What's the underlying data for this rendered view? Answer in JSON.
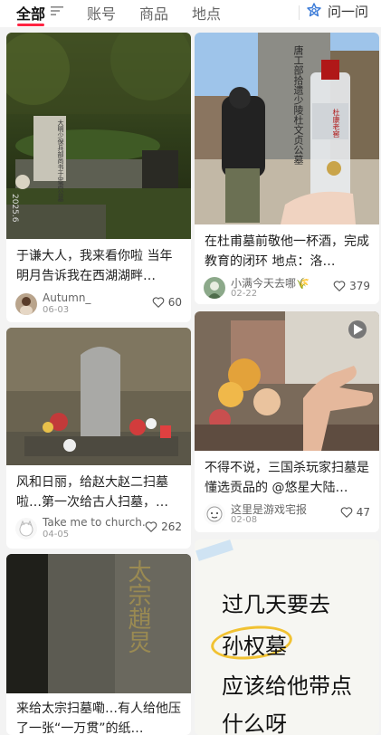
{
  "tabs": [
    "全部",
    "账号",
    "商品",
    "地点"
  ],
  "ask_label": "问一问",
  "cards": [
    {
      "title": "于谦大人，我来看你啦 当年明月告诉我在西湖湖畔…",
      "author": "Autumn_",
      "date": "06-03",
      "likes": "60",
      "img_text": "大明少保兵部尚书于忠肃公墓",
      "img_corner": "2025.6"
    },
    {
      "title": "在杜甫墓前敬他一杯酒，完成教育的闭环 地点：洛…",
      "author": "小满今天去哪🌾",
      "date": "02-22",
      "likes": "379",
      "img_text": "唐工部拾遗少陵杜文贞公墓",
      "bottle_brand": "杜康老窖"
    },
    {
      "title": "风和日丽，给赵大赵二扫墓啦…第一次给古人扫墓，…",
      "author": "Take me to church.",
      "date": "04-05",
      "likes": "262"
    },
    {
      "title": "不得不说，三国杀玩家扫墓是懂选贡品的 @悠星大陆…",
      "author": "这里是游戏宅报",
      "date": "02-08",
      "likes": "47"
    },
    {
      "title": "来给太宗扫墓嘞…有人给他压了一张“一万贯”的纸…",
      "img_text": "太宗趙炅"
    },
    {
      "note_lines": [
        "过几天要去",
        "孙权墓",
        "应该给他带点",
        "什么呀"
      ]
    }
  ]
}
